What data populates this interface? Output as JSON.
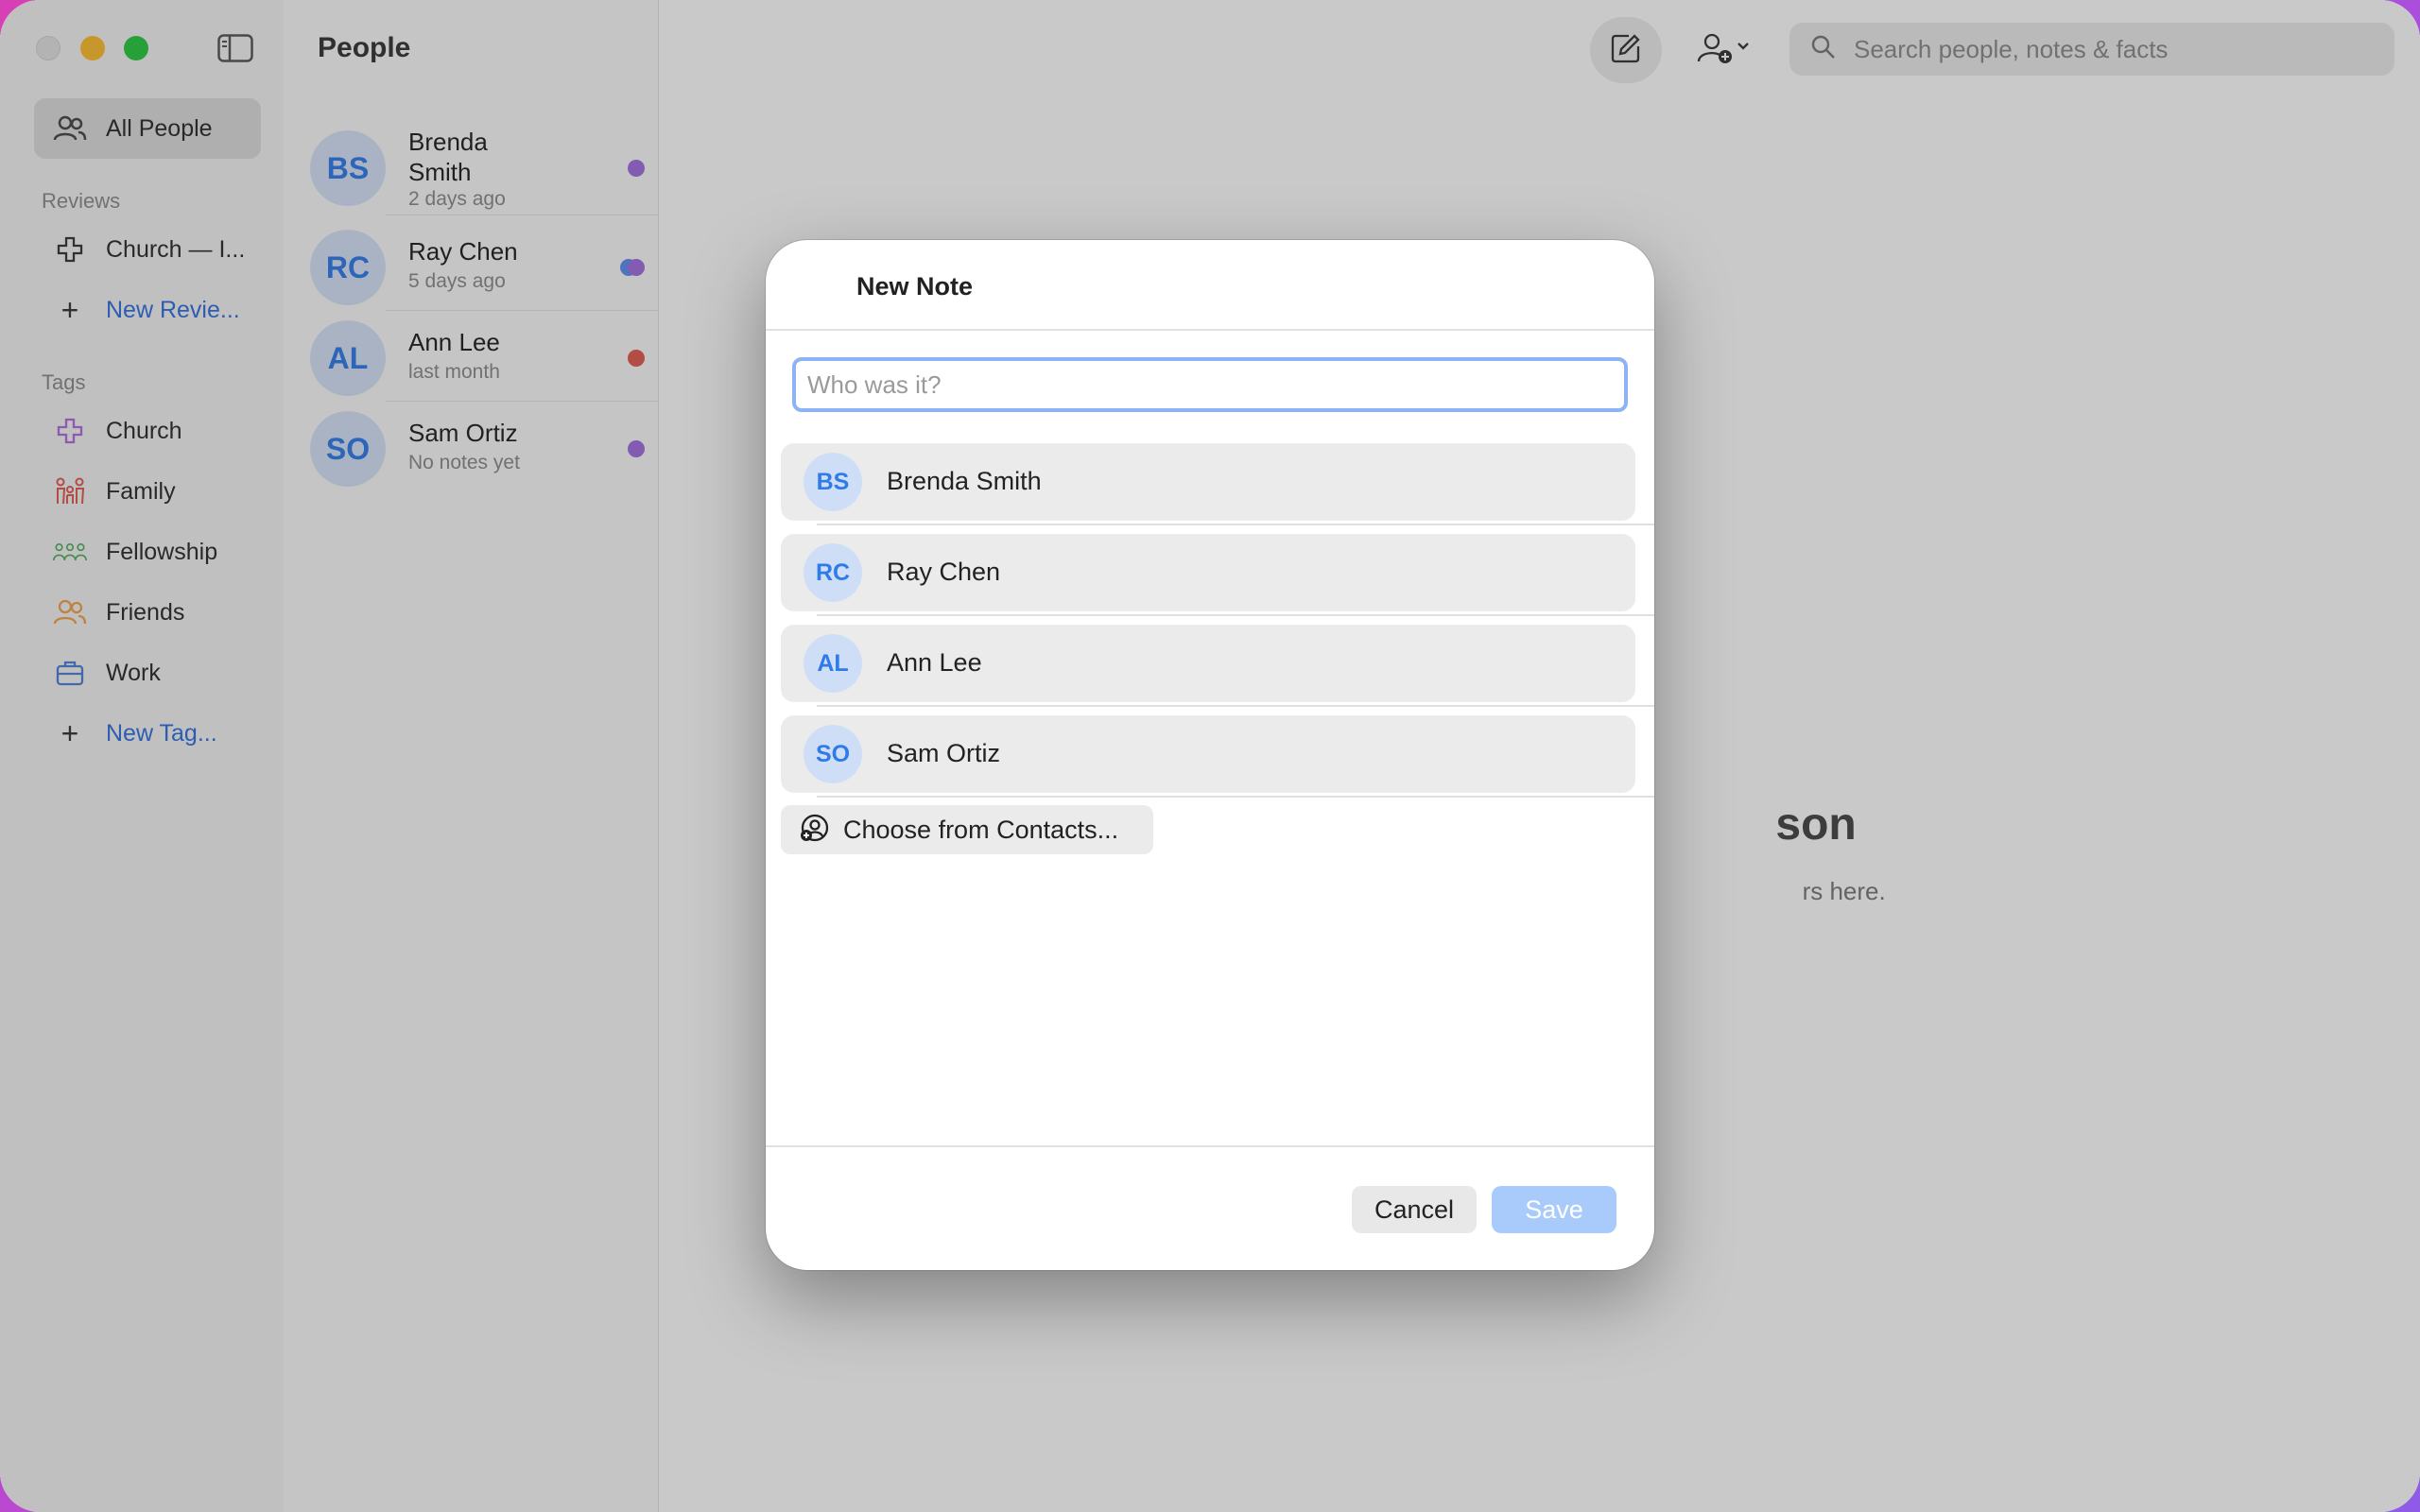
{
  "sidebar": {
    "all_people": "All People",
    "reviews_label": "Reviews",
    "reviews": [
      {
        "label": "Church — I..."
      }
    ],
    "new_review": "New Revie...",
    "tags_label": "Tags",
    "tags": [
      {
        "label": "Church",
        "icon": "cross-icon",
        "color": "#b06ae0"
      },
      {
        "label": "Family",
        "icon": "family-icon",
        "color": "#e0584e"
      },
      {
        "label": "Fellowship",
        "icon": "group-icon",
        "color": "#4cae5a"
      },
      {
        "label": "Friends",
        "icon": "friends-icon",
        "color": "#f0a04a"
      },
      {
        "label": "Work",
        "icon": "briefcase-icon",
        "color": "#4a7fd8"
      }
    ],
    "new_tag": "New Tag..."
  },
  "list": {
    "title": "People",
    "people": [
      {
        "initials": "BS",
        "name": "Brenda Smith",
        "name_line1": "Brenda",
        "name_line2": "Smith",
        "sub": "2 days ago",
        "dot_colors": [
          "#a06ee0"
        ]
      },
      {
        "initials": "RC",
        "name": "Ray Chen",
        "sub": "5 days ago",
        "dot_colors": [
          "#5b8ef0",
          "#a06ee0"
        ]
      },
      {
        "initials": "AL",
        "name": "Ann Lee",
        "sub": "last month",
        "dot_colors": [
          "#e0584e"
        ]
      },
      {
        "initials": "SO",
        "name": "Sam Ortiz",
        "sub": "No notes yet",
        "dot_colors": [
          "#a06ee0"
        ]
      }
    ]
  },
  "toolbar": {
    "search_placeholder": "Search people, notes & facts"
  },
  "main": {
    "empty_title_visible": "son",
    "empty_sub_visible": "rs here."
  },
  "dialog": {
    "title": "New Note",
    "input_placeholder": "Who was it?",
    "suggestions": [
      {
        "initials": "BS",
        "name": "Brenda Smith"
      },
      {
        "initials": "RC",
        "name": "Ray Chen"
      },
      {
        "initials": "AL",
        "name": "Ann Lee"
      },
      {
        "initials": "SO",
        "name": "Sam Ortiz"
      }
    ],
    "choose_contacts": "Choose from Contacts...",
    "cancel": "Cancel",
    "save": "Save"
  }
}
